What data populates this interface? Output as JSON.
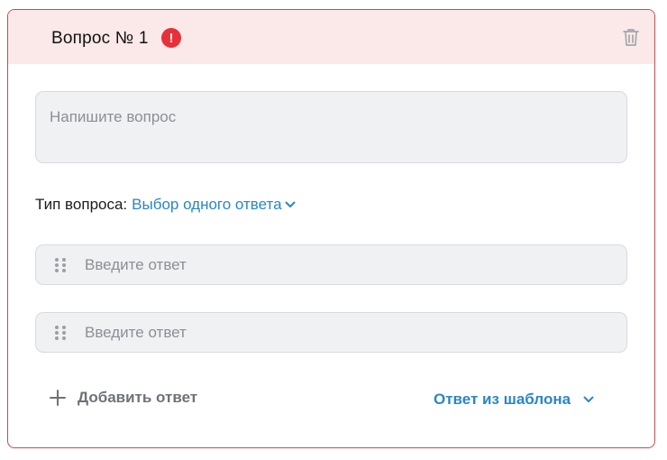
{
  "question": {
    "title": "Вопрос № 1",
    "error_mark": "!",
    "placeholder": "Напишите вопрос",
    "type_label": "Тип вопроса:",
    "type_value": "Выбор одного ответа"
  },
  "answers": [
    {
      "placeholder": "Введите ответ",
      "value": ""
    },
    {
      "placeholder": "Введите ответ",
      "value": ""
    }
  ],
  "actions": {
    "add_answer_label": "Добавить ответ",
    "template_answer_label": "Ответ из шаблона"
  },
  "icons": {
    "error": "exclamation-circle-icon",
    "delete": "trash-icon",
    "dropdown": "chevron-down-icon",
    "drag": "drag-handle-icon",
    "add": "plus-icon"
  },
  "colors": {
    "card_border": "#c94a4a",
    "header_background": "#fbe9e9",
    "error": "#e8303a",
    "link": "#2a85c9",
    "field_background": "#f0f1f3"
  }
}
